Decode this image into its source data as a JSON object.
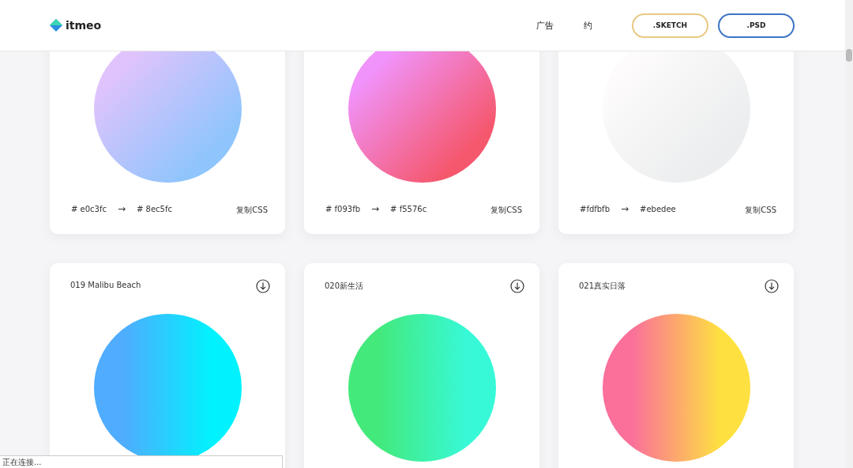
{
  "header": {
    "logo": "itmeo",
    "nav": [
      "广告",
      "约"
    ],
    "buttons": [
      {
        "label": ".SKETCH",
        "kind": "sketch"
      },
      {
        "label": ".PSD",
        "kind": "psd"
      }
    ]
  },
  "cards": [
    {
      "kind": "diagonal",
      "stops": [
        {
          "color": "#e0c3fc"
        },
        {
          "color": "#8ec5fc"
        }
      ],
      "from": "# e0c3fc",
      "arrow": "→",
      "to": "# 8ec5fc",
      "copy": "复制CSS"
    },
    {
      "kind": "diagonal",
      "stops": [
        {
          "color": "#f093fb"
        },
        {
          "color": "#f5576c"
        }
      ],
      "from": "# f093fb",
      "arrow": "→",
      "to": "# f5576c",
      "copy": "复制CSS"
    },
    {
      "kind": "diagonal",
      "stops": [
        {
          "color": "#fdfbfb"
        },
        {
          "color": "#ebedee"
        }
      ],
      "from": "#fdfbfb",
      "arrow": "→",
      "to": "#ebedee",
      "copy": "复制CSS"
    },
    {
      "kind": "horizontal",
      "title": "019 Malibu Beach",
      "stops": [
        {
          "color": "#4facfe"
        },
        {
          "color": "#00f2fe"
        }
      ]
    },
    {
      "kind": "horizontal",
      "title": "020新生活",
      "stops": [
        {
          "color": "#43e97b"
        },
        {
          "color": "#38f9d7"
        }
      ]
    },
    {
      "kind": "horizontal",
      "title": "021真实日落",
      "stops": [
        {
          "color": "#fa709a"
        },
        {
          "color": "#fee140"
        }
      ]
    }
  ],
  "status_bar": "正在连接..."
}
